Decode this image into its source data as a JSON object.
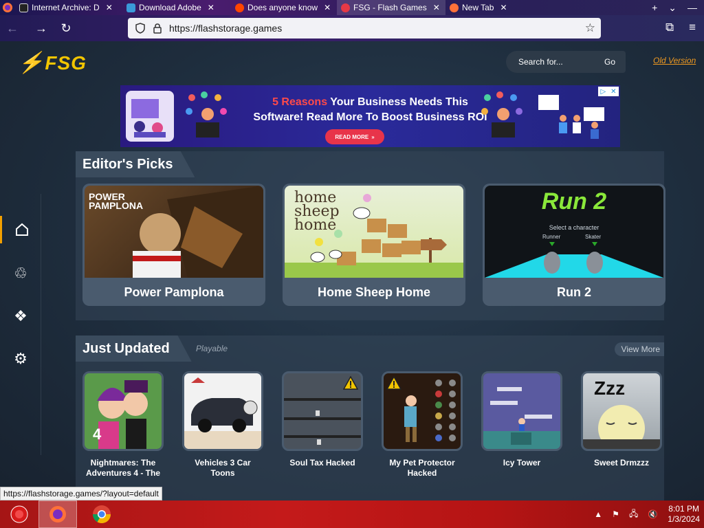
{
  "browser": {
    "tabs": [
      {
        "label": "Internet Archive: D",
        "icon_color": "#222222",
        "active": false
      },
      {
        "label": "Download Adobe",
        "icon_color": "#3a9ad9",
        "active": false
      },
      {
        "label": "Does anyone know",
        "icon_color": "#ff4500",
        "active": false
      },
      {
        "label": "FSG - Flash Games",
        "icon_color": "#e63946",
        "active": true
      },
      {
        "label": "New Tab",
        "icon_color": "#ff7139",
        "active": false
      }
    ],
    "url": "https://flashstorage.games"
  },
  "site": {
    "logo": "FSG",
    "search_placeholder": "Search for...",
    "search_go": "Go",
    "old_version": "Old Version"
  },
  "ad": {
    "highlight": "5 Reasons",
    "line1_rest": " Your Business Needs This",
    "line2": "Software! Read More To Boost Business ROI",
    "button": "READ MORE"
  },
  "editors_picks": {
    "title": "Editor's Picks",
    "games": [
      {
        "name": "Power Pamplona",
        "thumb_label": "POWER PAMPLONA"
      },
      {
        "name": "Home Sheep Home",
        "thumb_label": "home sheep home"
      },
      {
        "name": "Run 2",
        "thumb_label": "Run 2",
        "subtitle": "Select a character",
        "opt1": "Runner",
        "opt2": "Skater"
      }
    ]
  },
  "just_updated": {
    "title": "Just Updated",
    "subtitle": "Playable",
    "view_more": "View More",
    "games": [
      {
        "name": "Nightmares: The Adventures 4 - The",
        "warning": false,
        "badge": "4"
      },
      {
        "name": "Vehicles 3 Car Toons",
        "warning": false
      },
      {
        "name": "Soul Tax Hacked",
        "warning": true
      },
      {
        "name": "My Pet Protector Hacked",
        "warning": true
      },
      {
        "name": "Icy Tower",
        "warning": false
      },
      {
        "name": "Sweet Drmzzz",
        "warning": false,
        "badge": "Zzz"
      }
    ]
  },
  "status_url": "https://flashstorage.games/?layout=default",
  "taskbar": {
    "time": "8:01 PM",
    "date": "1/3/2024"
  },
  "colors": {
    "accent": "#f2c500",
    "orange": "#f09a20"
  }
}
